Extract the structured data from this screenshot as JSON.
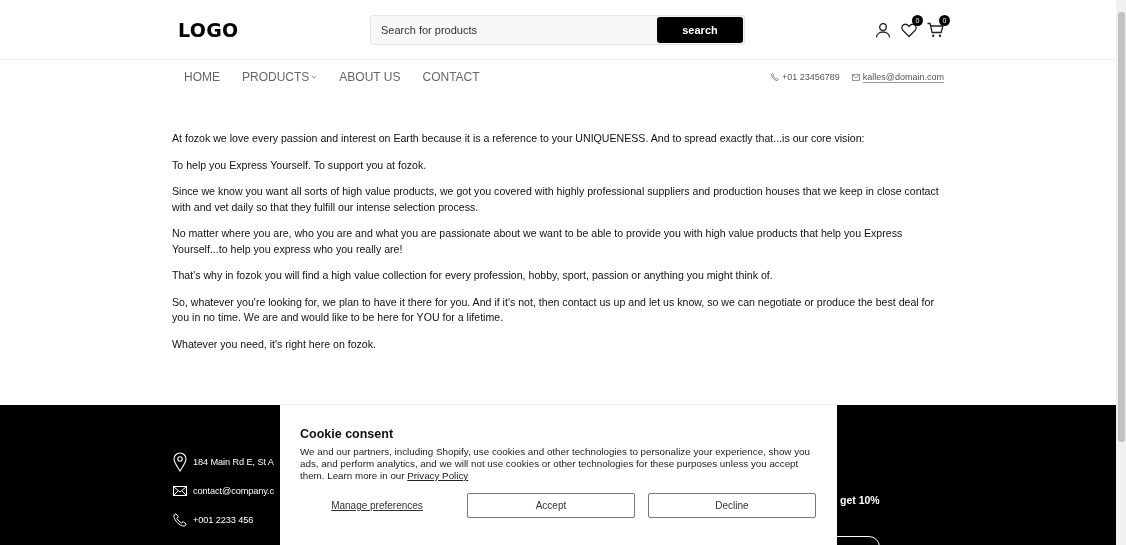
{
  "header": {
    "logo": "LOGO",
    "search": {
      "placeholder": "Search for products",
      "button": "search"
    },
    "wishlist_count": "0",
    "cart_count": "0"
  },
  "nav": {
    "items": [
      {
        "label": "HOME",
        "has_dropdown": false
      },
      {
        "label": "PRODUCTS",
        "has_dropdown": true
      },
      {
        "label": "ABOUT US",
        "has_dropdown": false
      },
      {
        "label": "CONTACT",
        "has_dropdown": false
      }
    ],
    "phone": "+01 23456789",
    "email": "kalles@domain.com"
  },
  "content": {
    "paragraphs": [
      "At fozok we love every passion and interest on Earth because it is a reference to your UNIQUENESS. And to spread exactly that...is our core vision:",
      "To help you Express Yourself. To support you at fozok.",
      "Since we know you want all sorts of high value products, we got you covered with highly professional suppliers and production houses that we keep in close contact with and vet daily so that they fulfill our intense selection process.",
      "No matter where you are, who you are and what you are passionate about we want to be able to provide you with high value products that help you Express Yourself...to help you express who you really are!",
      "That's why in fozok you will find a high value collection for every profession, hobby, sport, passion or anything you might think of.",
      "So, whatever you're looking for, we plan to have it there for you. And if it's not, then contact us up and let us know, so we can negotiate or produce the best deal for you in no time. We are and would like to be here for YOU for a lifetime.",
      "Whatever you need, it's right here on fozok."
    ]
  },
  "footer": {
    "contacts": [
      {
        "kind": "address",
        "text": "184 Main Rd E, St A"
      },
      {
        "kind": "email",
        "text": "contact@company.c"
      },
      {
        "kind": "phone",
        "text": "+001 2233 456"
      }
    ],
    "promo_text": "get 10%"
  },
  "cookie_consent": {
    "title": "Cookie consent",
    "body": "We and our partners, including Shopify, use cookies and other technologies to personalize your experience, show you ads, and perform analytics, and we will not use cookies or other technologies for these purposes unless you accept them. Learn more in our",
    "link": "Privacy Policy",
    "manage": "Manage preferences",
    "accept": "Accept",
    "decline": "Decline"
  }
}
